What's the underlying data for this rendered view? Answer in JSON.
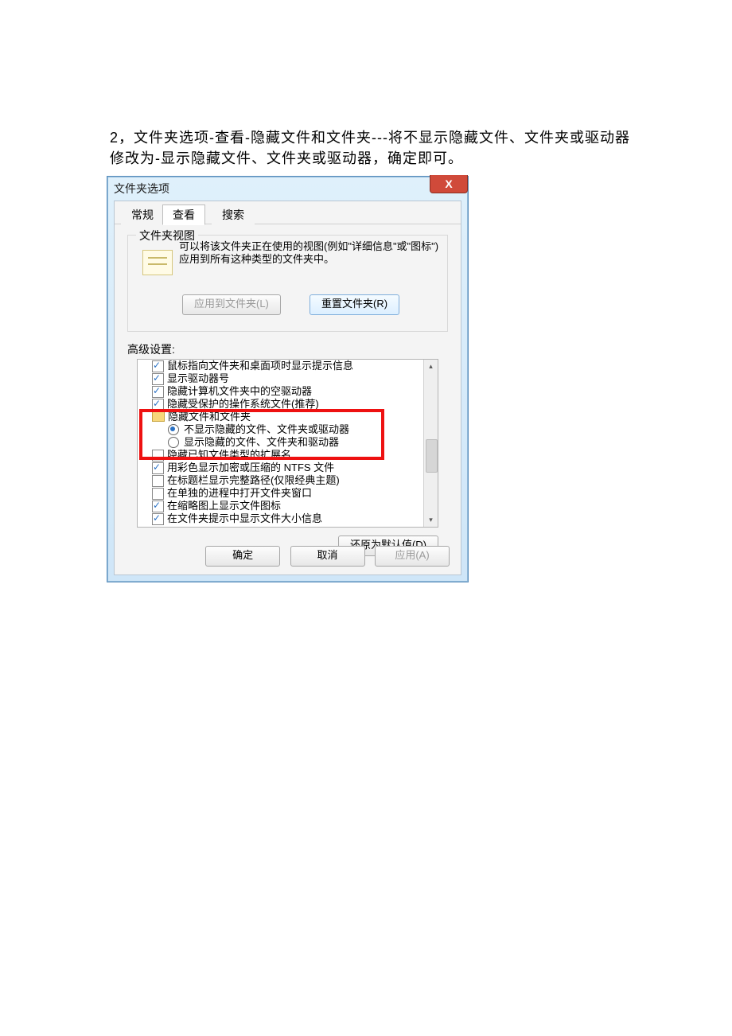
{
  "instruction": "2，文件夹选项-查看-隐藏文件和文件夹---将不显示隐藏文件、文件夹或驱动器修改为-显示隐藏文件、文件夹或驱动器，确定即可。",
  "dialog": {
    "title": "文件夹选项",
    "close_glyph": "X",
    "tabs": {
      "general": "常规",
      "view": "查看",
      "search": "搜索"
    },
    "folderViews": {
      "legend": "文件夹视图",
      "desc": "可以将该文件夹正在使用的视图(例如\"详细信息\"或\"图标\")应用到所有这种类型的文件夹中。",
      "apply": "应用到文件夹(L)",
      "reset": "重置文件夹(R)"
    },
    "advancedLabel": "高级设置:",
    "items": {
      "i0": "鼠标指向文件夹和桌面项时显示提示信息",
      "i1": "显示驱动器号",
      "i2": "隐藏计算机文件夹中的空驱动器",
      "i3": "隐藏受保护的操作系统文件(推荐)",
      "i4": "隐藏文件和文件夹",
      "i5": "不显示隐藏的文件、文件夹或驱动器",
      "i6": "显示隐藏的文件、文件夹和驱动器",
      "i7": "隐藏已知文件类型的扩展名",
      "i8": "用彩色显示加密或压缩的 NTFS 文件",
      "i9": "在标题栏显示完整路径(仅限经典主题)",
      "i10": "在单独的进程中打开文件夹窗口",
      "i11": "在缩略图上显示文件图标",
      "i12": "在文件夹提示中显示文件大小信息"
    },
    "restoreDefaults": "还原为默认值(D)",
    "ok": "确定",
    "cancel": "取消",
    "apply": "应用(A)"
  }
}
